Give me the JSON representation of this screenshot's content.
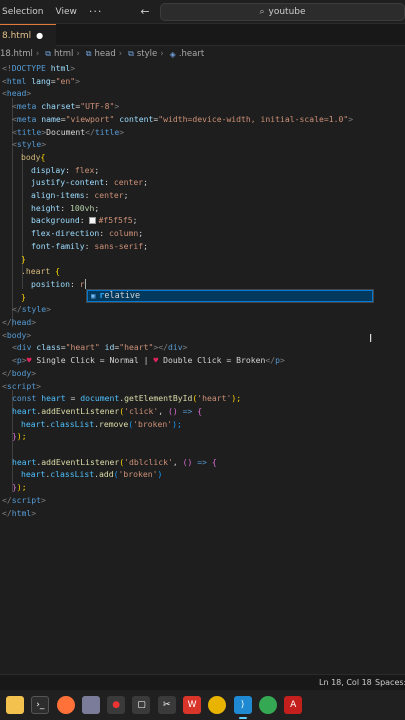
{
  "titlebar": {
    "menu": [
      "Selection",
      "View"
    ],
    "more_label": "···",
    "back_label": "←",
    "forward_label": "→",
    "search_text": "youtube"
  },
  "tab": {
    "filename": "8.html",
    "dirty_indicator": "●"
  },
  "breadcrumb": [
    "18.html",
    "html",
    "head",
    "style",
    ".heart"
  ],
  "editor": {
    "lines": {
      "l1": {
        "a": "<!",
        "b": "DOCTYPE",
        "c": " html",
        "d": ">"
      },
      "l2": {
        "a": "<",
        "b": "html",
        "c": " lang",
        "d": "=",
        "e": "\"en\"",
        "f": ">"
      },
      "l3": {
        "a": "<",
        "b": "head",
        "c": ">"
      },
      "l4": {
        "a": "<",
        "b": "meta",
        "c": " charset",
        "d": "=",
        "e": "\"UTF-8\"",
        "f": ">"
      },
      "l5": {
        "a": "<",
        "b": "meta",
        "c": " name",
        "d": "=",
        "e": "\"viewport\"",
        "f": " content",
        "g": "=",
        "h": "\"width=device-width, initial-scale=1.0\"",
        "i": ">"
      },
      "l6": {
        "a": "<",
        "b": "title",
        "c": ">",
        "d": "Document",
        "e": "</",
        "f": "title",
        "g": ">"
      },
      "l7": {
        "a": "<",
        "b": "style",
        "c": ">"
      },
      "l8": {
        "a": "body",
        "b": "{"
      },
      "l9": {
        "a": "display",
        "b": ": ",
        "c": "flex",
        "d": ";"
      },
      "l10": {
        "a": "justify-content",
        "b": ": ",
        "c": "center",
        "d": ";"
      },
      "l11": {
        "a": "align-items",
        "b": ": ",
        "c": "center",
        "d": ";"
      },
      "l12": {
        "a": "height",
        "b": ": ",
        "c": "100vh",
        "d": ";"
      },
      "l13": {
        "a": "background",
        "b": ": ",
        "c": "#f5f5f5",
        "d": ";"
      },
      "l14": {
        "a": "flex-direction",
        "b": ": ",
        "c": "column",
        "d": ";"
      },
      "l15": {
        "a": "font-family",
        "b": ": ",
        "c": "sans-serif",
        "d": ";"
      },
      "l16": {
        "a": "}"
      },
      "l17": {
        "a": ".heart",
        "b": " {"
      },
      "l18": {
        "a": "position",
        "b": ": ",
        "c": "r"
      },
      "l19": {
        "a": "}"
      },
      "l20": {
        "a": "</",
        "b": "style",
        "c": ">"
      },
      "l21": {
        "a": "</",
        "b": "head",
        "c": ">"
      },
      "l22": {
        "a": "<",
        "b": "body",
        "c": ">"
      },
      "l23": {
        "a": "<",
        "b": "div",
        "c": " class",
        "d": "=",
        "e": "\"heart\"",
        "f": " id",
        "g": "=",
        "h": "\"heart\"",
        "i": "></",
        "j": "div",
        "k": ">"
      },
      "l24": {
        "a": "<",
        "b": "p",
        "c": ">",
        "d": "♥",
        "e": " Single Click = Normal | ",
        "f": "♥",
        "g": " Double Click = Broken",
        "h": "</",
        "i": "p",
        "j": ">"
      },
      "l25": {
        "a": "</",
        "b": "body",
        "c": ">"
      },
      "l26": {
        "a": "<",
        "b": "script",
        "c": ">"
      },
      "l27": {
        "a": "const",
        "b": " heart",
        "c": " = ",
        "d": "document",
        "e": ".",
        "f": "getElementById",
        "g": "(",
        "h": "'heart'",
        "i": ");"
      },
      "l28": {
        "a": "heart",
        "b": ".",
        "c": "addEventListener",
        "d": "(",
        "e": "'click'",
        "f": ", ",
        "g": "()",
        "h": " => ",
        "i": "{"
      },
      "l29": {
        "a": "heart",
        "b": ".",
        "c": "classList",
        "d": ".",
        "e": "remove",
        "f": "(",
        "g": "'broken'",
        "h": ");"
      },
      "l30": {
        "a": "}",
        "b": ");"
      },
      "l31": {
        "a": ""
      },
      "l32": {
        "a": "heart",
        "b": ".",
        "c": "addEventListener",
        "d": "(",
        "e": "'dblclick'",
        "f": ", ",
        "g": "()",
        "h": " => ",
        "i": "{"
      },
      "l33": {
        "a": "heart",
        "b": ".",
        "c": "classList",
        "d": ".",
        "e": "add",
        "f": "(",
        "g": "'broken'",
        "h": ")"
      },
      "l34": {
        "a": "}",
        "b": ");"
      },
      "l35": {
        "a": "</",
        "b": "script",
        "c": ">"
      },
      "l36": {
        "a": "</",
        "b": "html",
        "c": ">"
      }
    },
    "suggestion": {
      "match": "r",
      "rest": "elative",
      "icon": "property-icon"
    }
  },
  "statusbar": {
    "position": "Ln 18, Col 18",
    "indent": "Spaces:"
  },
  "taskbar": {
    "icons": [
      "file-explorer-icon",
      "terminal-icon",
      "firefox-icon",
      "brave-icon",
      "paint-icon",
      "app-icon",
      "snip-icon",
      "wps-icon",
      "chrome-icon",
      "vscode-icon",
      "chrome-profile-icon",
      "acrobat-icon"
    ]
  },
  "colors": {
    "accent": "#0078d4",
    "editor_bg": "#1e1e1e",
    "tab_modified": "#e2c08d"
  }
}
